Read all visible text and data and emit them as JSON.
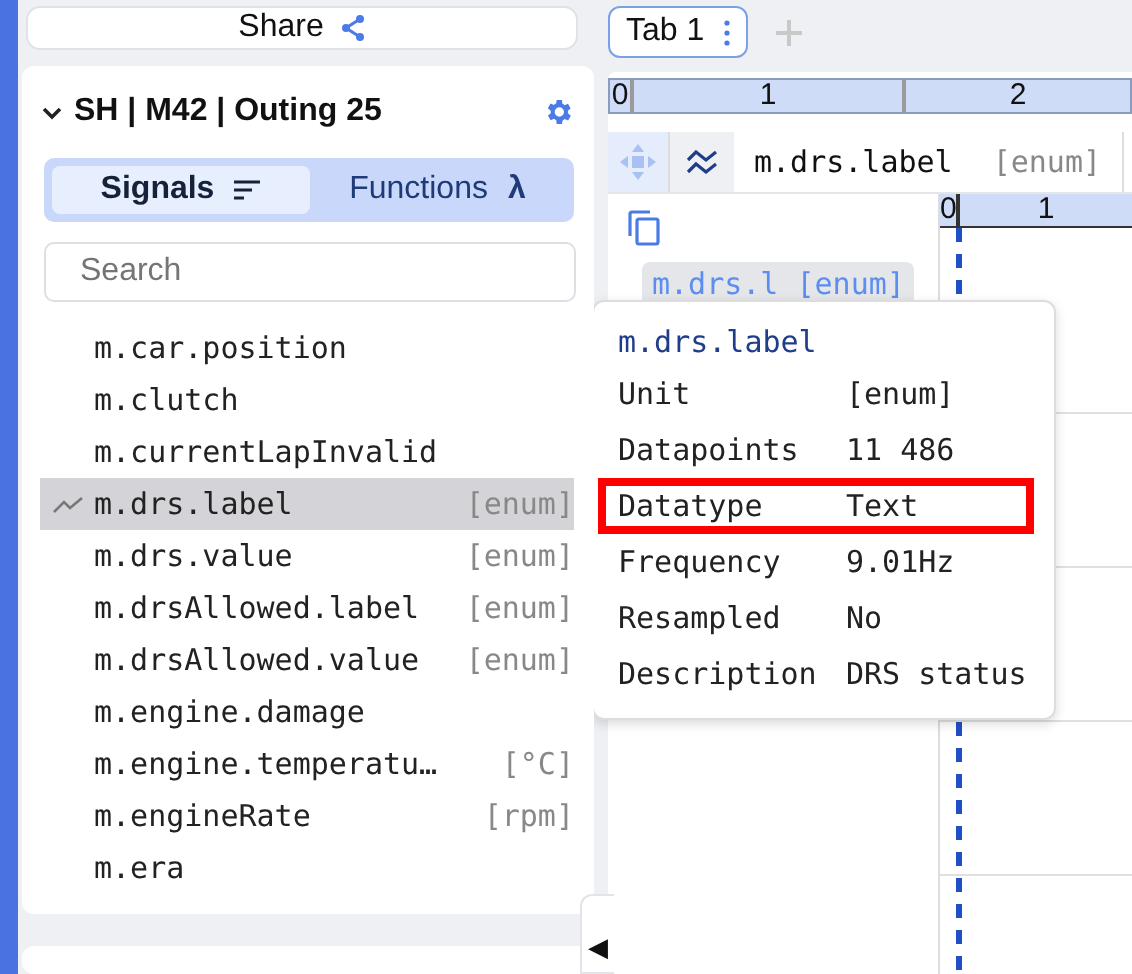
{
  "share_button": {
    "label": "Share"
  },
  "dataset": {
    "title": "SH | M42 | Outing 25",
    "expanded": true
  },
  "mode_tabs": [
    {
      "label": "Signals",
      "selected": true,
      "kind": "sort"
    },
    {
      "label": "Functions",
      "selected": false,
      "kind": "symbol",
      "symbol": "λ"
    }
  ],
  "search": {
    "placeholder": "Search"
  },
  "signals": [
    {
      "name": "m.car.position",
      "selected": false
    },
    {
      "name": "m.clutch",
      "selected": false
    },
    {
      "name": "m.currentLapInvalid",
      "selected": false
    },
    {
      "name": "m.drs.label",
      "unit": "[enum]",
      "selected": true
    },
    {
      "name": "m.drs.value",
      "unit": "[enum]",
      "selected": false
    },
    {
      "name": "m.drsAllowed.label",
      "unit": "[enum]",
      "selected": false
    },
    {
      "name": "m.drsAllowed.value",
      "unit": "[enum]",
      "selected": false
    },
    {
      "name": "m.engine.damage",
      "selected": false
    },
    {
      "name": "m.engine.temperatu…",
      "unit": "[°C]",
      "selected": false
    },
    {
      "name": "m.engineRate",
      "unit": "[rpm]",
      "selected": false
    },
    {
      "name": "m.era",
      "selected": false
    }
  ],
  "tabs": [
    {
      "label": "Tab 1",
      "selected": true
    }
  ],
  "ruler": {
    "labels": [
      "0",
      "1",
      "2"
    ]
  },
  "plot": {
    "signal": "m.drs.label",
    "unit": "[enum]",
    "chip": "m.drs.l [enum]",
    "ruler_labels": [
      "0",
      "1"
    ]
  },
  "tooltip": {
    "title": "m.drs.label",
    "rows": [
      {
        "label": "Unit",
        "value": "[enum]",
        "highlighted": false
      },
      {
        "label": "Datapoints",
        "value": "11 486",
        "highlighted": false
      },
      {
        "label": "Datatype",
        "value": "Text",
        "highlighted": true
      },
      {
        "label": "Frequency",
        "value": "9.01Hz",
        "highlighted": false
      },
      {
        "label": "Resampled",
        "value": "No",
        "highlighted": false
      },
      {
        "label": "Description",
        "value": "DRS status",
        "highlighted": false
      }
    ]
  },
  "collapse_handle": "◀"
}
